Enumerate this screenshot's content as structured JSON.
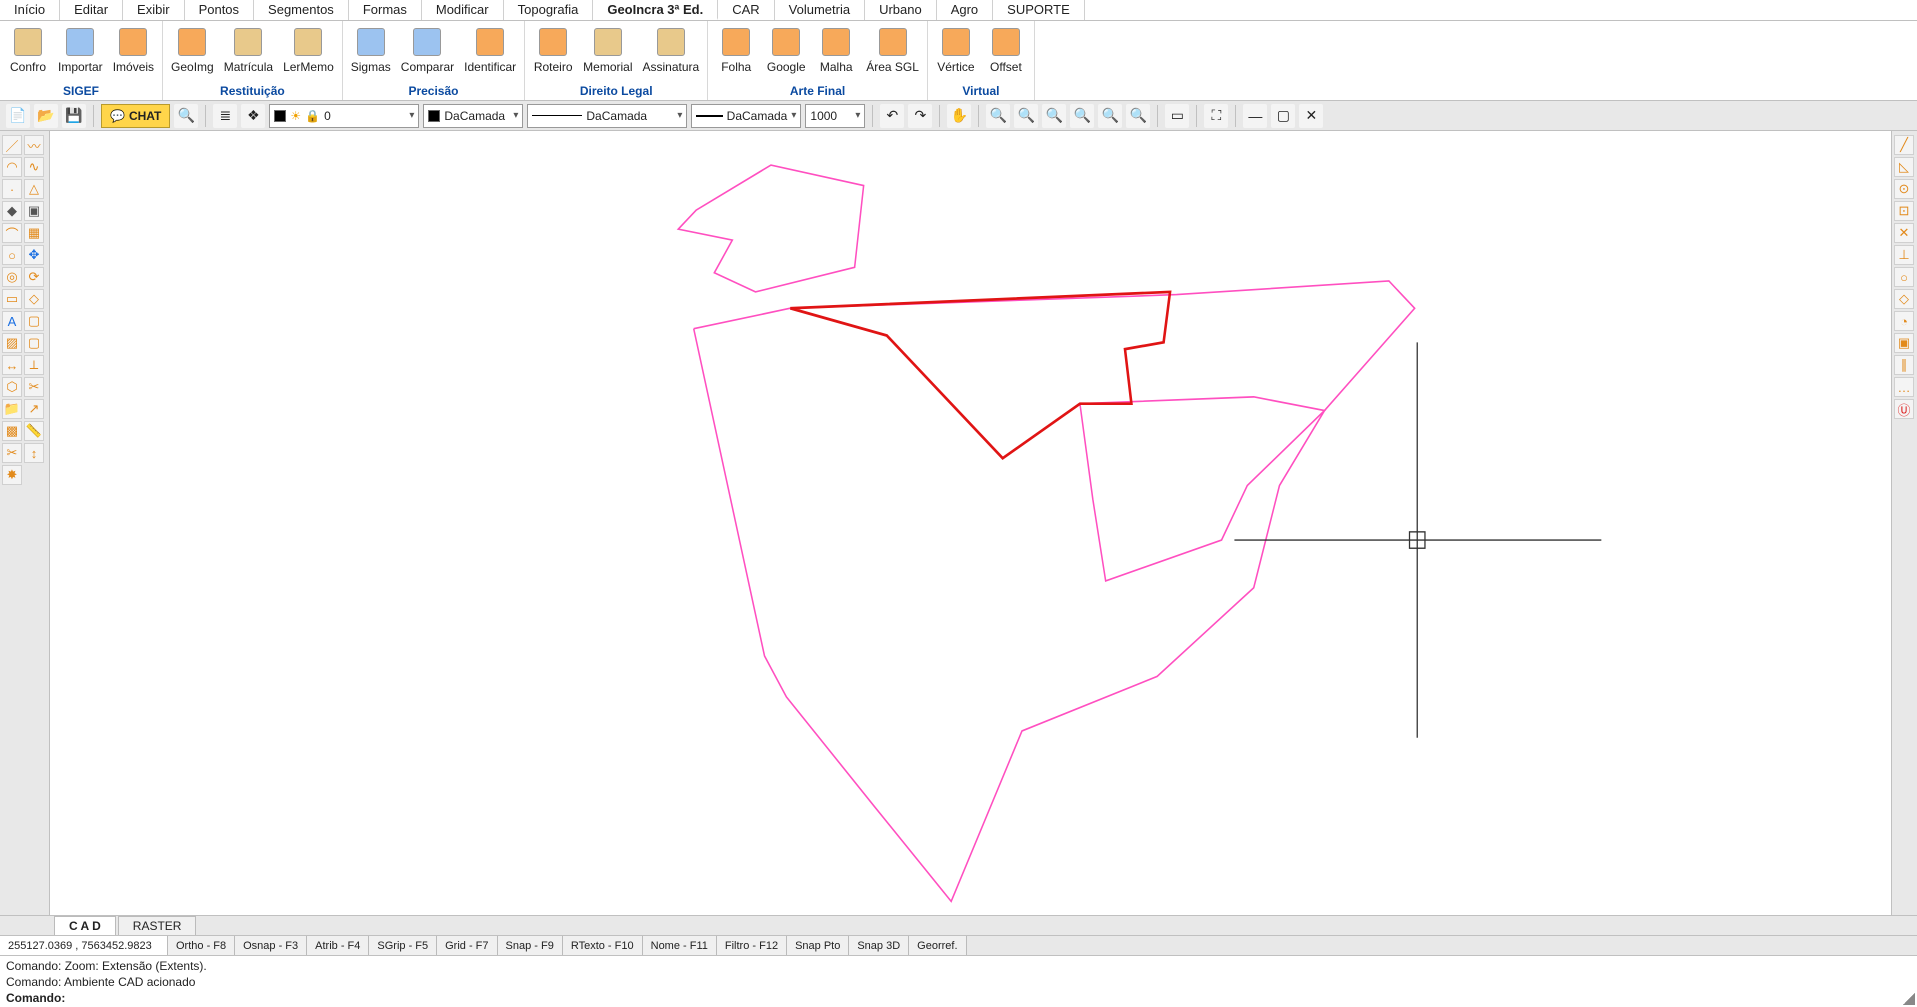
{
  "menu": {
    "items": [
      "Início",
      "Editar",
      "Exibir",
      "Pontos",
      "Segmentos",
      "Formas",
      "Modificar",
      "Topografia",
      "GeoIncra 3ª Ed.",
      "CAR",
      "Volumetria",
      "Urbano",
      "Agro",
      "SUPORTE"
    ],
    "activeIndex": 8
  },
  "ribbon": {
    "groups": [
      {
        "title": "SIGEF",
        "items": [
          "Confro",
          "Importar",
          "Imóveis"
        ]
      },
      {
        "title": "Restituição",
        "items": [
          "GeoImg",
          "Matrícula",
          "LerMemo"
        ]
      },
      {
        "title": "Precisão",
        "items": [
          "Sigmas",
          "Comparar",
          "Identificar"
        ]
      },
      {
        "title": "Direito Legal",
        "items": [
          "Roteiro",
          "Memorial",
          "Assinatura"
        ]
      },
      {
        "title": "Arte Final",
        "items": [
          "Folha",
          "Google",
          "Malha",
          "Área SGL"
        ]
      },
      {
        "title": "Virtual",
        "items": [
          "Vértice",
          "Offset"
        ]
      }
    ]
  },
  "toolbar": {
    "chat": "CHAT",
    "layer_value": "0",
    "color_value": "DaCamada",
    "linetype_value": "DaCamada",
    "lineweight_value": "DaCamada",
    "scale_value": "1000"
  },
  "bottomTabs": {
    "tabs": [
      "C A D",
      "RASTER"
    ],
    "activeIndex": 0
  },
  "status": {
    "coords": "255127.0369 , 7563452.9823",
    "items": [
      "Ortho - F8",
      "Osnap - F3",
      "Atrib - F4",
      "SGrip - F5",
      "Grid - F7",
      "Snap - F9",
      "RTexto - F10",
      "Nome - F11",
      "Filtro - F12",
      "Snap Pto",
      "Snap 3D",
      "Georref."
    ]
  },
  "cmdlog": {
    "lines": [
      "Comando: Zoom: Extensão (Extents).",
      "Comando: Ambiente CAD acionado"
    ],
    "prompt": "Comando:"
  }
}
